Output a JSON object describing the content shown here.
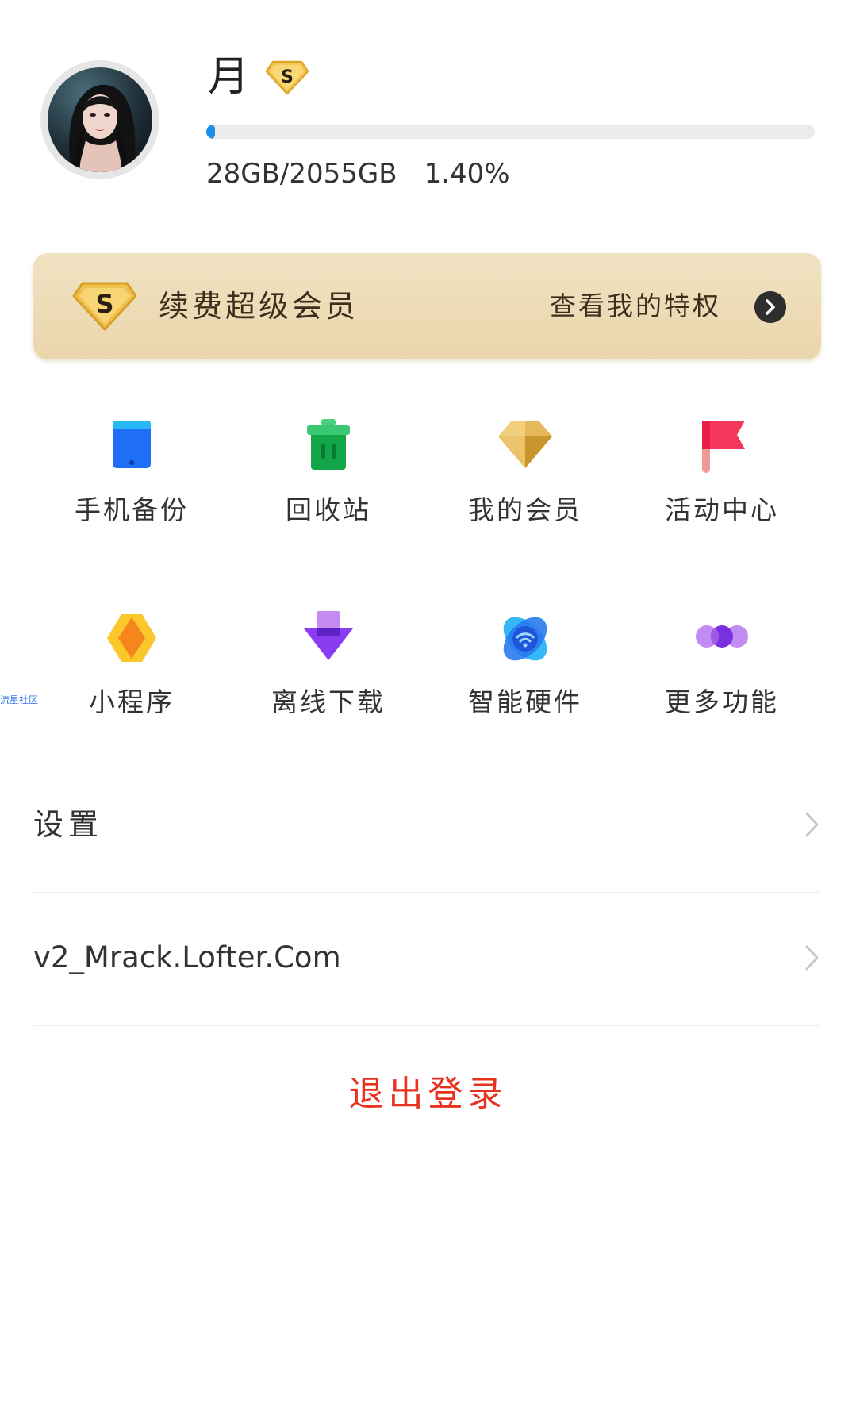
{
  "profile": {
    "username": "月",
    "quota_used": "28GB",
    "quota_total": "2055GB",
    "quota_text": "28GB/2055GB",
    "quota_percent_text": "1.40%",
    "quota_fraction": 0.014,
    "accent_color": "#1a8ff2"
  },
  "vip_banner": {
    "title": "续费超级会员",
    "link_label": "查看我的特权",
    "badge_icon": "super-vip-s-badge-icon",
    "arrow_icon": "chevron-right-circle-icon",
    "gradient": [
      "#f0e2c3",
      "#ead6ab"
    ]
  },
  "features": [
    {
      "label": "手机备份",
      "icon": "phone-backup-icon"
    },
    {
      "label": "回收站",
      "icon": "recycle-bin-icon"
    },
    {
      "label": "我的会员",
      "icon": "diamond-membership-icon"
    },
    {
      "label": "活动中心",
      "icon": "flag-activity-icon"
    },
    {
      "label": "小程序",
      "icon": "mini-program-icon"
    },
    {
      "label": "离线下载",
      "icon": "offline-download-icon"
    },
    {
      "label": "智能硬件",
      "icon": "smart-hardware-icon"
    },
    {
      "label": "更多功能",
      "icon": "more-features-icon"
    }
  ],
  "watermark": "流星社区",
  "list": {
    "settings_label": "设置",
    "link_label": "v2_Mrack.Lofter.Com"
  },
  "logout_label": "退出登录",
  "colors": {
    "logout": "#e8321e",
    "text": "#333333",
    "divider": "#eeeeee"
  }
}
